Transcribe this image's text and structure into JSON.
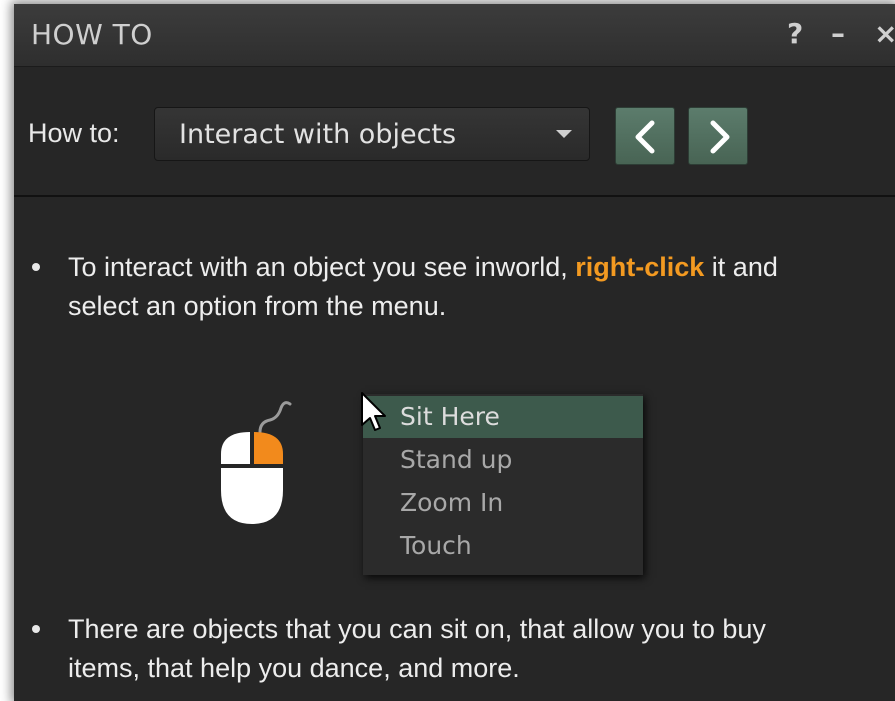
{
  "window": {
    "title": "HOW TO",
    "help_label": "?",
    "minimize_label": "–",
    "close_label": "×"
  },
  "toolbar": {
    "howto_label": "How to:",
    "dropdown_value": "Interact with objects",
    "prev_icon": "chevron-left-icon",
    "next_icon": "chevron-right-icon"
  },
  "content": {
    "para1": {
      "text_a": "To interact with an object you see inworld, ",
      "highlight": "right-click",
      "text_b": " it and select an option from the menu."
    },
    "menu_items": [
      "Sit Here",
      "Stand up",
      "Zoom In",
      "Touch"
    ],
    "para2": "There are objects that you can sit on, that allow you to buy items, that help you dance, and more."
  },
  "colors": {
    "background": "#262626",
    "accent_orange": "#f39a21",
    "nav_green": "#5c7c6c",
    "menu_highlight": "#3d5a4c"
  }
}
